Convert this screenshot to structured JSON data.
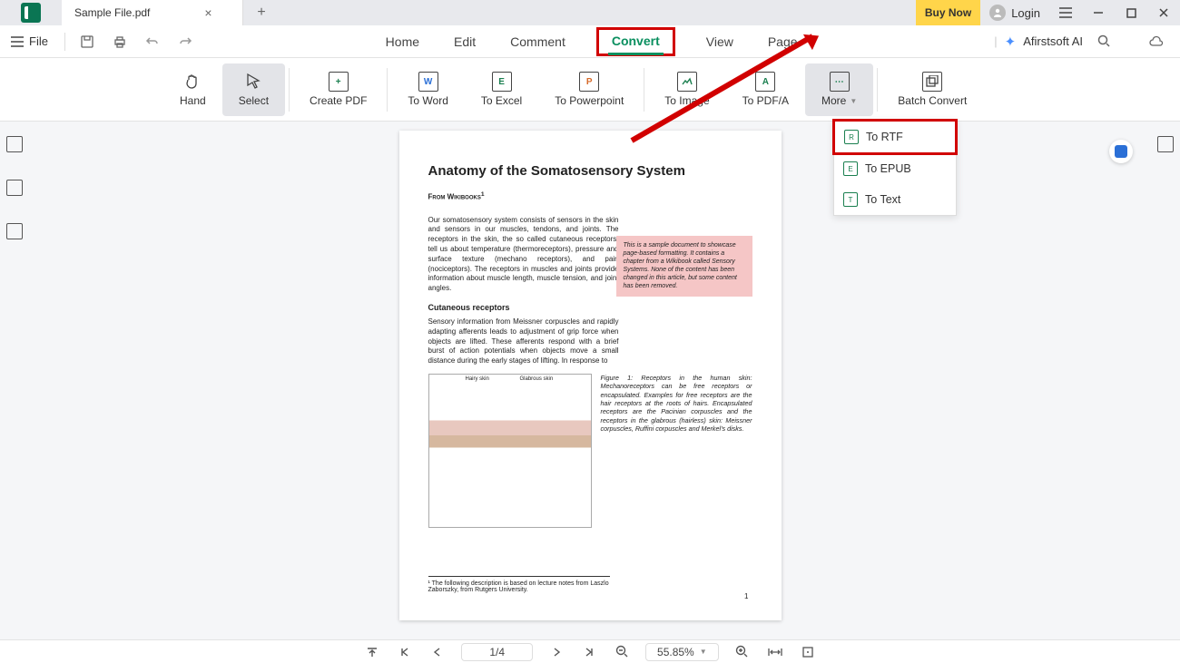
{
  "titlebar": {
    "tab_name": "Sample File.pdf",
    "buy": "Buy Now",
    "login": "Login"
  },
  "quickbar": {
    "file": "File"
  },
  "menu": {
    "home": "Home",
    "edit": "Edit",
    "comment": "Comment",
    "convert": "Convert",
    "view": "View",
    "page": "Page",
    "ai": "Afirstsoft AI"
  },
  "ribbon": {
    "hand": "Hand",
    "select": "Select",
    "create": "Create PDF",
    "toword": "To Word",
    "toexcel": "To Excel",
    "toppt": "To Powerpoint",
    "toimg": "To Image",
    "topdfa": "To PDF/A",
    "more": "More",
    "batch": "Batch Convert"
  },
  "dropdown": {
    "rtf": "To RTF",
    "epub": "To EPUB",
    "text": "To Text"
  },
  "doc": {
    "title": "Anatomy of the Somatosensory System",
    "from": "From Wikibooks",
    "para1": "Our somatosensory system consists of sensors in the skin and sensors in our muscles, tendons, and joints. The receptors in the skin, the so called cutaneous receptors, tell us about temperature (thermoreceptors), pressure and surface texture (mechano receptors), and pain (nociceptors). The receptors in muscles and joints provide information about muscle length, muscle tension, and joint angles.",
    "note": "This is a sample document to showcase page-based formatting. It contains a chapter from a Wikibook called Sensory Systems. None of the content has been changed in this article, but some content has been removed.",
    "sub": "Cutaneous receptors",
    "para2": "Sensory information from Meissner corpuscles and rapidly adapting afferents leads to adjustment of grip force when objects are lifted. These afferents respond with a brief burst of action potentials when objects move a small distance during the early stages of lifting. In response to",
    "figcap": "Figure 1: Receptors in the human skin: Mechanoreceptors can be free receptors or encapsulated. Examples for free receptors are the hair receptors at the roots of hairs. Encapsulated receptors are the Pacinian corpuscles and the receptors in the glabrous (hairless) skin: Meissner corpuscles, Ruffini corpuscles and Merkel's disks.",
    "footnote": "¹ The following description is based on lecture notes from Laszlo Zaborszky, from Rutgers University.",
    "pagenum": "1"
  },
  "status": {
    "page": "1/4",
    "zoom": "55.85%"
  }
}
